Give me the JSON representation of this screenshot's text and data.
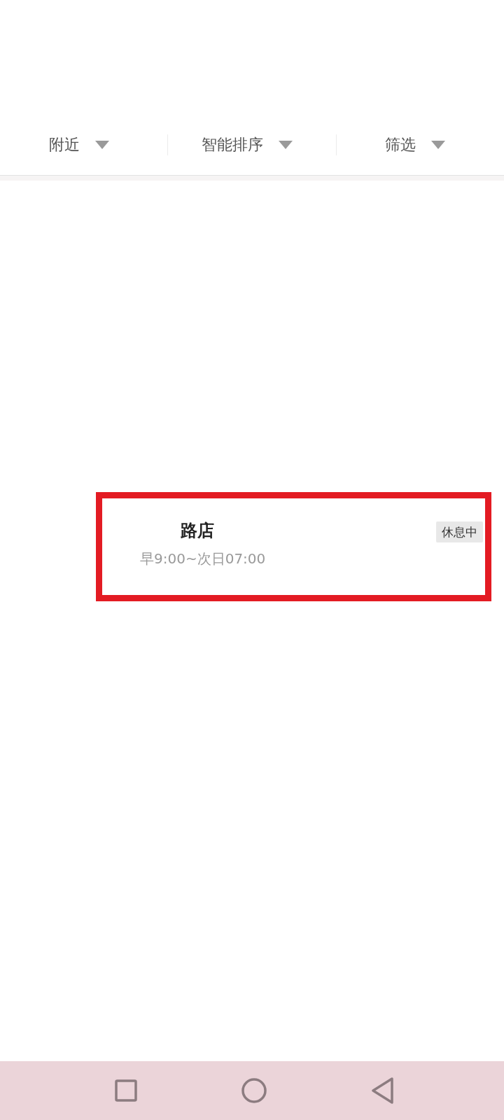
{
  "filters": [
    {
      "label": "附近"
    },
    {
      "label": "智能排序"
    },
    {
      "label": "筛选"
    }
  ],
  "stores": [
    {
      "name": "路店",
      "hours": "早9:00~次日07:00",
      "status": "休息中",
      "highlighted": true
    }
  ],
  "nav_bar": {
    "buttons": [
      {
        "kind": "recents"
      },
      {
        "kind": "home"
      },
      {
        "kind": "back"
      }
    ]
  }
}
